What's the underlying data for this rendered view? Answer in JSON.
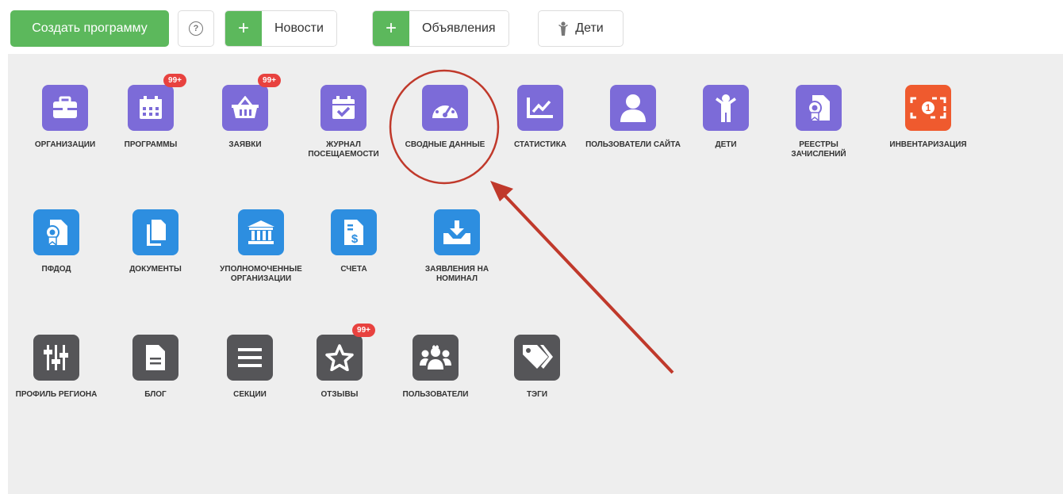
{
  "toolbar": {
    "create_label": "Создать программу",
    "news_label": "Новости",
    "ads_label": "Объявления",
    "kids_label": "Дети",
    "plus": "+",
    "help": "?"
  },
  "tiles": [
    {
      "label": "ОРГАНИЗАЦИИ",
      "icon": "briefcase-icon",
      "color": "#7c6bd8"
    },
    {
      "label": "ПРОГРАММЫ",
      "icon": "calendar-icon",
      "color": "#7c6bd8",
      "badge": "99+"
    },
    {
      "label": "ЗАЯВКИ",
      "icon": "basket-icon",
      "color": "#7c6bd8",
      "badge": "99+"
    },
    {
      "label": "ЖУРНАЛ ПОСЕЩАЕМОСТИ",
      "icon": "calendar-check-icon",
      "color": "#7c6bd8"
    },
    {
      "label": "СВОДНЫЕ ДАННЫЕ",
      "icon": "dashboard-icon",
      "color": "#7c6bd8"
    },
    {
      "label": "СТАТИСТИКА",
      "icon": "chart-line-icon",
      "color": "#7c6bd8"
    },
    {
      "label": "ПОЛЬЗОВАТЕЛИ САЙТА",
      "icon": "user-icon",
      "color": "#7c6bd8"
    },
    {
      "label": "ДЕТИ",
      "icon": "child-icon",
      "color": "#7c6bd8"
    },
    {
      "label": "РЕЕСТРЫ ЗАЧИСЛЕНИЙ",
      "icon": "certificate-icon",
      "color": "#7c6bd8"
    },
    {
      "label": "ИНВЕНТАРИЗАЦИЯ",
      "icon": "money-icon",
      "color": "#ef5a2e"
    },
    {
      "label": "ПФДОД",
      "icon": "certificate-icon",
      "color": "#2d8ee0"
    },
    {
      "label": "ДОКУМЕНТЫ",
      "icon": "documents-icon",
      "color": "#2d8ee0"
    },
    {
      "label": "УПОЛНОМОЧЕННЫЕ ОРГАНИЗАЦИИ",
      "icon": "bank-icon",
      "color": "#2d8ee0"
    },
    {
      "label": "СЧЕТА",
      "icon": "invoice-icon",
      "color": "#2d8ee0"
    },
    {
      "label": "ЗАЯВЛЕНИЯ НА НОМИНАЛ",
      "icon": "inbox-download-icon",
      "color": "#2d8ee0"
    },
    {
      "label": "ПРОФИЛЬ РЕГИОНА",
      "icon": "sliders-icon",
      "color": "#555558"
    },
    {
      "label": "БЛОГ",
      "icon": "file-text-icon",
      "color": "#555558"
    },
    {
      "label": "СЕКЦИИ",
      "icon": "list-icon",
      "color": "#555558"
    },
    {
      "label": "ОТЗЫВЫ",
      "icon": "star-icon",
      "color": "#555558",
      "badge": "99+"
    },
    {
      "label": "ПОЛЬЗОВАТЕЛИ",
      "icon": "users-icon",
      "color": "#555558"
    },
    {
      "label": "ТЭГИ",
      "icon": "tags-icon",
      "color": "#555558"
    }
  ],
  "annotation": {
    "color": "#c0392b"
  }
}
